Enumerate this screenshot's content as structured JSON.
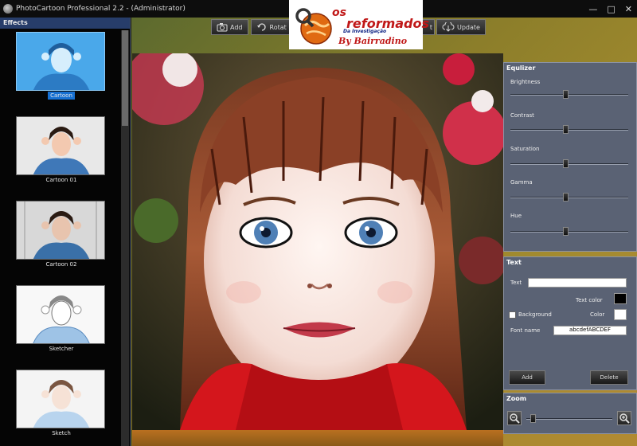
{
  "window": {
    "title": "PhotoCartoon Professional 2.2 - (Administrator)",
    "minimize_glyph": "—",
    "maximize_glyph": "□",
    "close_glyph": "✕"
  },
  "watermark": {
    "line1": "os",
    "line2": "reformados",
    "line3": "Da Investigação",
    "line4": "By Bairradino"
  },
  "effects": {
    "title": "Effects",
    "items": [
      {
        "label": "Cartoon",
        "selected": true
      },
      {
        "label": "Cartoon 01",
        "selected": false
      },
      {
        "label": "Cartoon 02",
        "selected": false
      },
      {
        "label": "Sketcher",
        "selected": false
      },
      {
        "label": "Sketch",
        "selected": false
      }
    ]
  },
  "toolbar": {
    "add_label": "Add",
    "rotate_label": "Rotat",
    "export_label": "t",
    "update_label": "Update"
  },
  "equalizer": {
    "title": "Equlizer",
    "sliders": [
      {
        "label": "Brightness",
        "value": 0.47
      },
      {
        "label": "Contrast",
        "value": 0.47
      },
      {
        "label": "Saturation",
        "value": 0.47
      },
      {
        "label": "Gamma",
        "value": 0.47
      },
      {
        "label": "Hue",
        "value": 0.47
      }
    ]
  },
  "text_panel": {
    "title": "Text",
    "text_label": "Text",
    "text_value": "",
    "text_color_label": "Text color",
    "text_color": "#000000",
    "background_label": "Background",
    "color_label": "Color",
    "bg_color": "#ffffff",
    "font_name_label": "Font name",
    "font_name_value": "abcdefABCDEF",
    "add_label": "Add",
    "delete_label": "Delete"
  },
  "zoom": {
    "title": "Zoom",
    "value": 0.05
  },
  "colors": {
    "accent": "#1670d2",
    "panel": "#5a6274"
  },
  "icons": {
    "add": "camera-icon",
    "rotate": "rotate-icon",
    "update": "cloud-download-icon",
    "zoom_out": "zoom-out-icon",
    "zoom_in": "zoom-in-icon"
  }
}
